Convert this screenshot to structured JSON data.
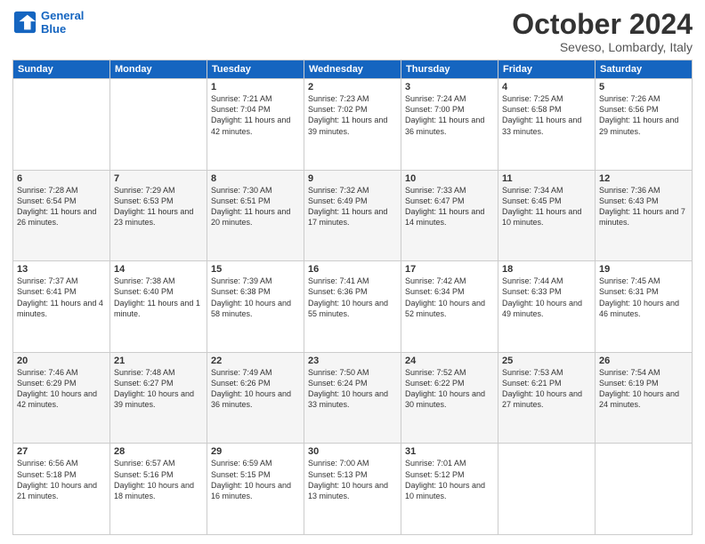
{
  "logo": {
    "line1": "General",
    "line2": "Blue"
  },
  "title": "October 2024",
  "location": "Seveso, Lombardy, Italy",
  "days_of_week": [
    "Sunday",
    "Monday",
    "Tuesday",
    "Wednesday",
    "Thursday",
    "Friday",
    "Saturday"
  ],
  "weeks": [
    [
      {
        "day": "",
        "content": ""
      },
      {
        "day": "",
        "content": ""
      },
      {
        "day": "1",
        "content": "Sunrise: 7:21 AM\nSunset: 7:04 PM\nDaylight: 11 hours and 42 minutes."
      },
      {
        "day": "2",
        "content": "Sunrise: 7:23 AM\nSunset: 7:02 PM\nDaylight: 11 hours and 39 minutes."
      },
      {
        "day": "3",
        "content": "Sunrise: 7:24 AM\nSunset: 7:00 PM\nDaylight: 11 hours and 36 minutes."
      },
      {
        "day": "4",
        "content": "Sunrise: 7:25 AM\nSunset: 6:58 PM\nDaylight: 11 hours and 33 minutes."
      },
      {
        "day": "5",
        "content": "Sunrise: 7:26 AM\nSunset: 6:56 PM\nDaylight: 11 hours and 29 minutes."
      }
    ],
    [
      {
        "day": "6",
        "content": "Sunrise: 7:28 AM\nSunset: 6:54 PM\nDaylight: 11 hours and 26 minutes."
      },
      {
        "day": "7",
        "content": "Sunrise: 7:29 AM\nSunset: 6:53 PM\nDaylight: 11 hours and 23 minutes."
      },
      {
        "day": "8",
        "content": "Sunrise: 7:30 AM\nSunset: 6:51 PM\nDaylight: 11 hours and 20 minutes."
      },
      {
        "day": "9",
        "content": "Sunrise: 7:32 AM\nSunset: 6:49 PM\nDaylight: 11 hours and 17 minutes."
      },
      {
        "day": "10",
        "content": "Sunrise: 7:33 AM\nSunset: 6:47 PM\nDaylight: 11 hours and 14 minutes."
      },
      {
        "day": "11",
        "content": "Sunrise: 7:34 AM\nSunset: 6:45 PM\nDaylight: 11 hours and 10 minutes."
      },
      {
        "day": "12",
        "content": "Sunrise: 7:36 AM\nSunset: 6:43 PM\nDaylight: 11 hours and 7 minutes."
      }
    ],
    [
      {
        "day": "13",
        "content": "Sunrise: 7:37 AM\nSunset: 6:41 PM\nDaylight: 11 hours and 4 minutes."
      },
      {
        "day": "14",
        "content": "Sunrise: 7:38 AM\nSunset: 6:40 PM\nDaylight: 11 hours and 1 minute."
      },
      {
        "day": "15",
        "content": "Sunrise: 7:39 AM\nSunset: 6:38 PM\nDaylight: 10 hours and 58 minutes."
      },
      {
        "day": "16",
        "content": "Sunrise: 7:41 AM\nSunset: 6:36 PM\nDaylight: 10 hours and 55 minutes."
      },
      {
        "day": "17",
        "content": "Sunrise: 7:42 AM\nSunset: 6:34 PM\nDaylight: 10 hours and 52 minutes."
      },
      {
        "day": "18",
        "content": "Sunrise: 7:44 AM\nSunset: 6:33 PM\nDaylight: 10 hours and 49 minutes."
      },
      {
        "day": "19",
        "content": "Sunrise: 7:45 AM\nSunset: 6:31 PM\nDaylight: 10 hours and 46 minutes."
      }
    ],
    [
      {
        "day": "20",
        "content": "Sunrise: 7:46 AM\nSunset: 6:29 PM\nDaylight: 10 hours and 42 minutes."
      },
      {
        "day": "21",
        "content": "Sunrise: 7:48 AM\nSunset: 6:27 PM\nDaylight: 10 hours and 39 minutes."
      },
      {
        "day": "22",
        "content": "Sunrise: 7:49 AM\nSunset: 6:26 PM\nDaylight: 10 hours and 36 minutes."
      },
      {
        "day": "23",
        "content": "Sunrise: 7:50 AM\nSunset: 6:24 PM\nDaylight: 10 hours and 33 minutes."
      },
      {
        "day": "24",
        "content": "Sunrise: 7:52 AM\nSunset: 6:22 PM\nDaylight: 10 hours and 30 minutes."
      },
      {
        "day": "25",
        "content": "Sunrise: 7:53 AM\nSunset: 6:21 PM\nDaylight: 10 hours and 27 minutes."
      },
      {
        "day": "26",
        "content": "Sunrise: 7:54 AM\nSunset: 6:19 PM\nDaylight: 10 hours and 24 minutes."
      }
    ],
    [
      {
        "day": "27",
        "content": "Sunrise: 6:56 AM\nSunset: 5:18 PM\nDaylight: 10 hours and 21 minutes."
      },
      {
        "day": "28",
        "content": "Sunrise: 6:57 AM\nSunset: 5:16 PM\nDaylight: 10 hours and 18 minutes."
      },
      {
        "day": "29",
        "content": "Sunrise: 6:59 AM\nSunset: 5:15 PM\nDaylight: 10 hours and 16 minutes."
      },
      {
        "day": "30",
        "content": "Sunrise: 7:00 AM\nSunset: 5:13 PM\nDaylight: 10 hours and 13 minutes."
      },
      {
        "day": "31",
        "content": "Sunrise: 7:01 AM\nSunset: 5:12 PM\nDaylight: 10 hours and 10 minutes."
      },
      {
        "day": "",
        "content": ""
      },
      {
        "day": "",
        "content": ""
      }
    ]
  ]
}
